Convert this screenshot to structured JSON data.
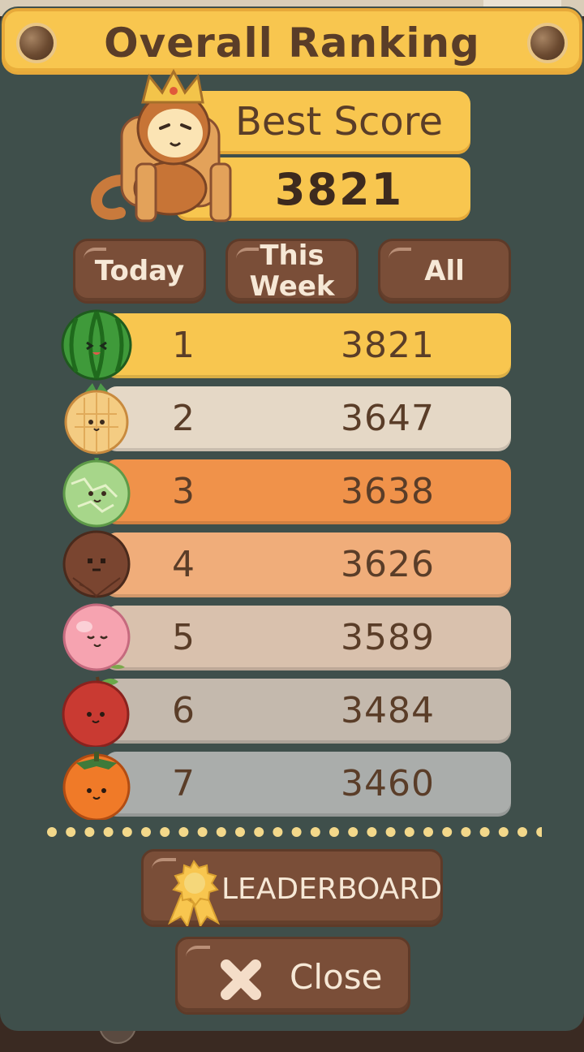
{
  "title": "Overall Ranking",
  "best": {
    "label": "Best Score",
    "value": "3821"
  },
  "tabs": [
    {
      "label": "Today"
    },
    {
      "label": "This\nWeek"
    },
    {
      "label": "All"
    }
  ],
  "rankings": [
    {
      "rank": "1",
      "score": "3821",
      "fruit": "watermelon",
      "color": "#f8c64f"
    },
    {
      "rank": "2",
      "score": "3647",
      "fruit": "pineapple",
      "color": "#e5d8c6"
    },
    {
      "rank": "3",
      "score": "3638",
      "fruit": "melon",
      "color": "#f0924a"
    },
    {
      "rank": "4",
      "score": "3626",
      "fruit": "coconut",
      "color": "#f0ad7a"
    },
    {
      "rank": "5",
      "score": "3589",
      "fruit": "peach",
      "color": "#d9c1ad"
    },
    {
      "rank": "6",
      "score": "3484",
      "fruit": "apple",
      "color": "#c4b9ad"
    },
    {
      "rank": "7",
      "score": "3460",
      "fruit": "persimmon",
      "color": "#aaadab"
    }
  ],
  "buttons": {
    "leaderboard": "LEADERBOARD",
    "close": "Close"
  },
  "icons": {
    "leaderboard": "award-ribbon-icon",
    "close": "close-x-icon",
    "mascot": "crowned-monkey-on-throne"
  }
}
